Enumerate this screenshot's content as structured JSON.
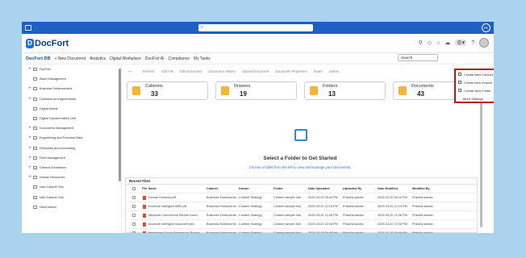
{
  "app": {
    "name": "DocFort",
    "topbar_avatar": "PK"
  },
  "header": {
    "icons": [
      "search-icon",
      "notification-icon",
      "help-icon",
      "cloud-icon",
      "gear-icon",
      "question-icon",
      "avatar"
    ]
  },
  "menubar": {
    "items": [
      {
        "label": "DocFort DB",
        "bold": true
      },
      {
        "label": "+ New Document"
      },
      {
        "label": "Analytics"
      },
      {
        "label": "Digital Workplace"
      },
      {
        "label": "DocFort AI"
      },
      {
        "label": "Compliance"
      },
      {
        "label": "My Tasks"
      }
    ],
    "search_label": "Search"
  },
  "dropdown": {
    "items": [
      "Create New Cabinet",
      "Create New Drawer",
      "Create New Folder",
      "More Settings"
    ]
  },
  "sidebar": {
    "items": [
      {
        "label": "DocFort",
        "expandable": true
      },
      {
        "label": "Asset Management",
        "expandable": false
      },
      {
        "label": "Business Enhancement",
        "expandable": true
      },
      {
        "label": "Contracts and Agreements",
        "expandable": true
      },
      {
        "label": "Digital Mobile",
        "expandable": false
      },
      {
        "label": "Digital Transformation Unit",
        "expandable": false
      },
      {
        "label": "Documents Management",
        "expandable": true
      },
      {
        "label": "Engineering and Technical Data",
        "expandable": true
      },
      {
        "label": "Financials and Accounting",
        "expandable": true
      },
      {
        "label": "Fleet Management",
        "expandable": true
      },
      {
        "label": "General Excellence",
        "expandable": true
      },
      {
        "label": "Human Resources",
        "expandable": true
      },
      {
        "label": "New Cabinet Test",
        "expandable": false
      },
      {
        "label": "New Cabinet Test",
        "expandable": false
      },
      {
        "label": "NewCabinet",
        "expandable": false
      }
    ]
  },
  "toolbar": {
    "items": [
      "Refresh",
      "Add File",
      "Edit Document",
      "Document History",
      "Upload Document",
      "Document Properties",
      "Share",
      "Delete"
    ]
  },
  "cards": [
    {
      "label": "Cabinets",
      "count": "33"
    },
    {
      "label": "Drawers",
      "count": "19"
    },
    {
      "label": "Folders",
      "count": "13"
    },
    {
      "label": "Documents",
      "count": "43"
    }
  ],
  "empty_state": {
    "title": "Select a Folder to Get Started",
    "subtitle": "Choose a folder from the left to view and manage your documents."
  },
  "recent": {
    "title": "Recent Files",
    "columns": [
      "File Name",
      "Cabinet",
      "Drawer",
      "Folder",
      "Date Uploaded",
      "Uploaded By",
      "Date Modified",
      "Modified By"
    ],
    "rows": [
      [
        "Human Persona.pdf",
        "Business Enhanceme...",
        "Content Strategy",
        "Content sample fold",
        "2025-03-20 05:44 PM",
        "Priscilla sobota",
        "2025-03-20 05:44 PM",
        "Priscilla sobota"
      ],
      [
        "brochure intelligent ABB.pdf",
        "Business Enhanceme...",
        "Content Strategy",
        "Content sample fold",
        "2025-03-20 12:19 PM",
        "Priscilla sobota",
        "2025-03-20 12:19 PM",
        "Priscilla sobota"
      ],
      [
        "Microsoft Commercial Partner Incen...",
        "Business Enhanceme...",
        "Content Strategy",
        "Content sample fold",
        "2025-03-20 12:08 PM",
        "Priscilla sobota",
        "2025-03-20 12:08 PM",
        "Priscilla sobota"
      ],
      [
        "brochure intelligent document pro...",
        "Business Enhanceme...",
        "Content Strategy",
        "Content sample fold",
        "2025-03-20 12:06 PM",
        "Priscilla sobota",
        "2025-03-20 12:06 PM",
        "Priscilla sobota"
      ],
      [
        "Beekeeper Group Request for Propos...",
        "Business Enhanceme...",
        "Content Strategy",
        "Content sample fold",
        "2025-03-20 09:48 AM",
        "Priscilla sobota",
        "2025-03-20 09:48 AM",
        "Priscilla sobota"
      ]
    ]
  }
}
